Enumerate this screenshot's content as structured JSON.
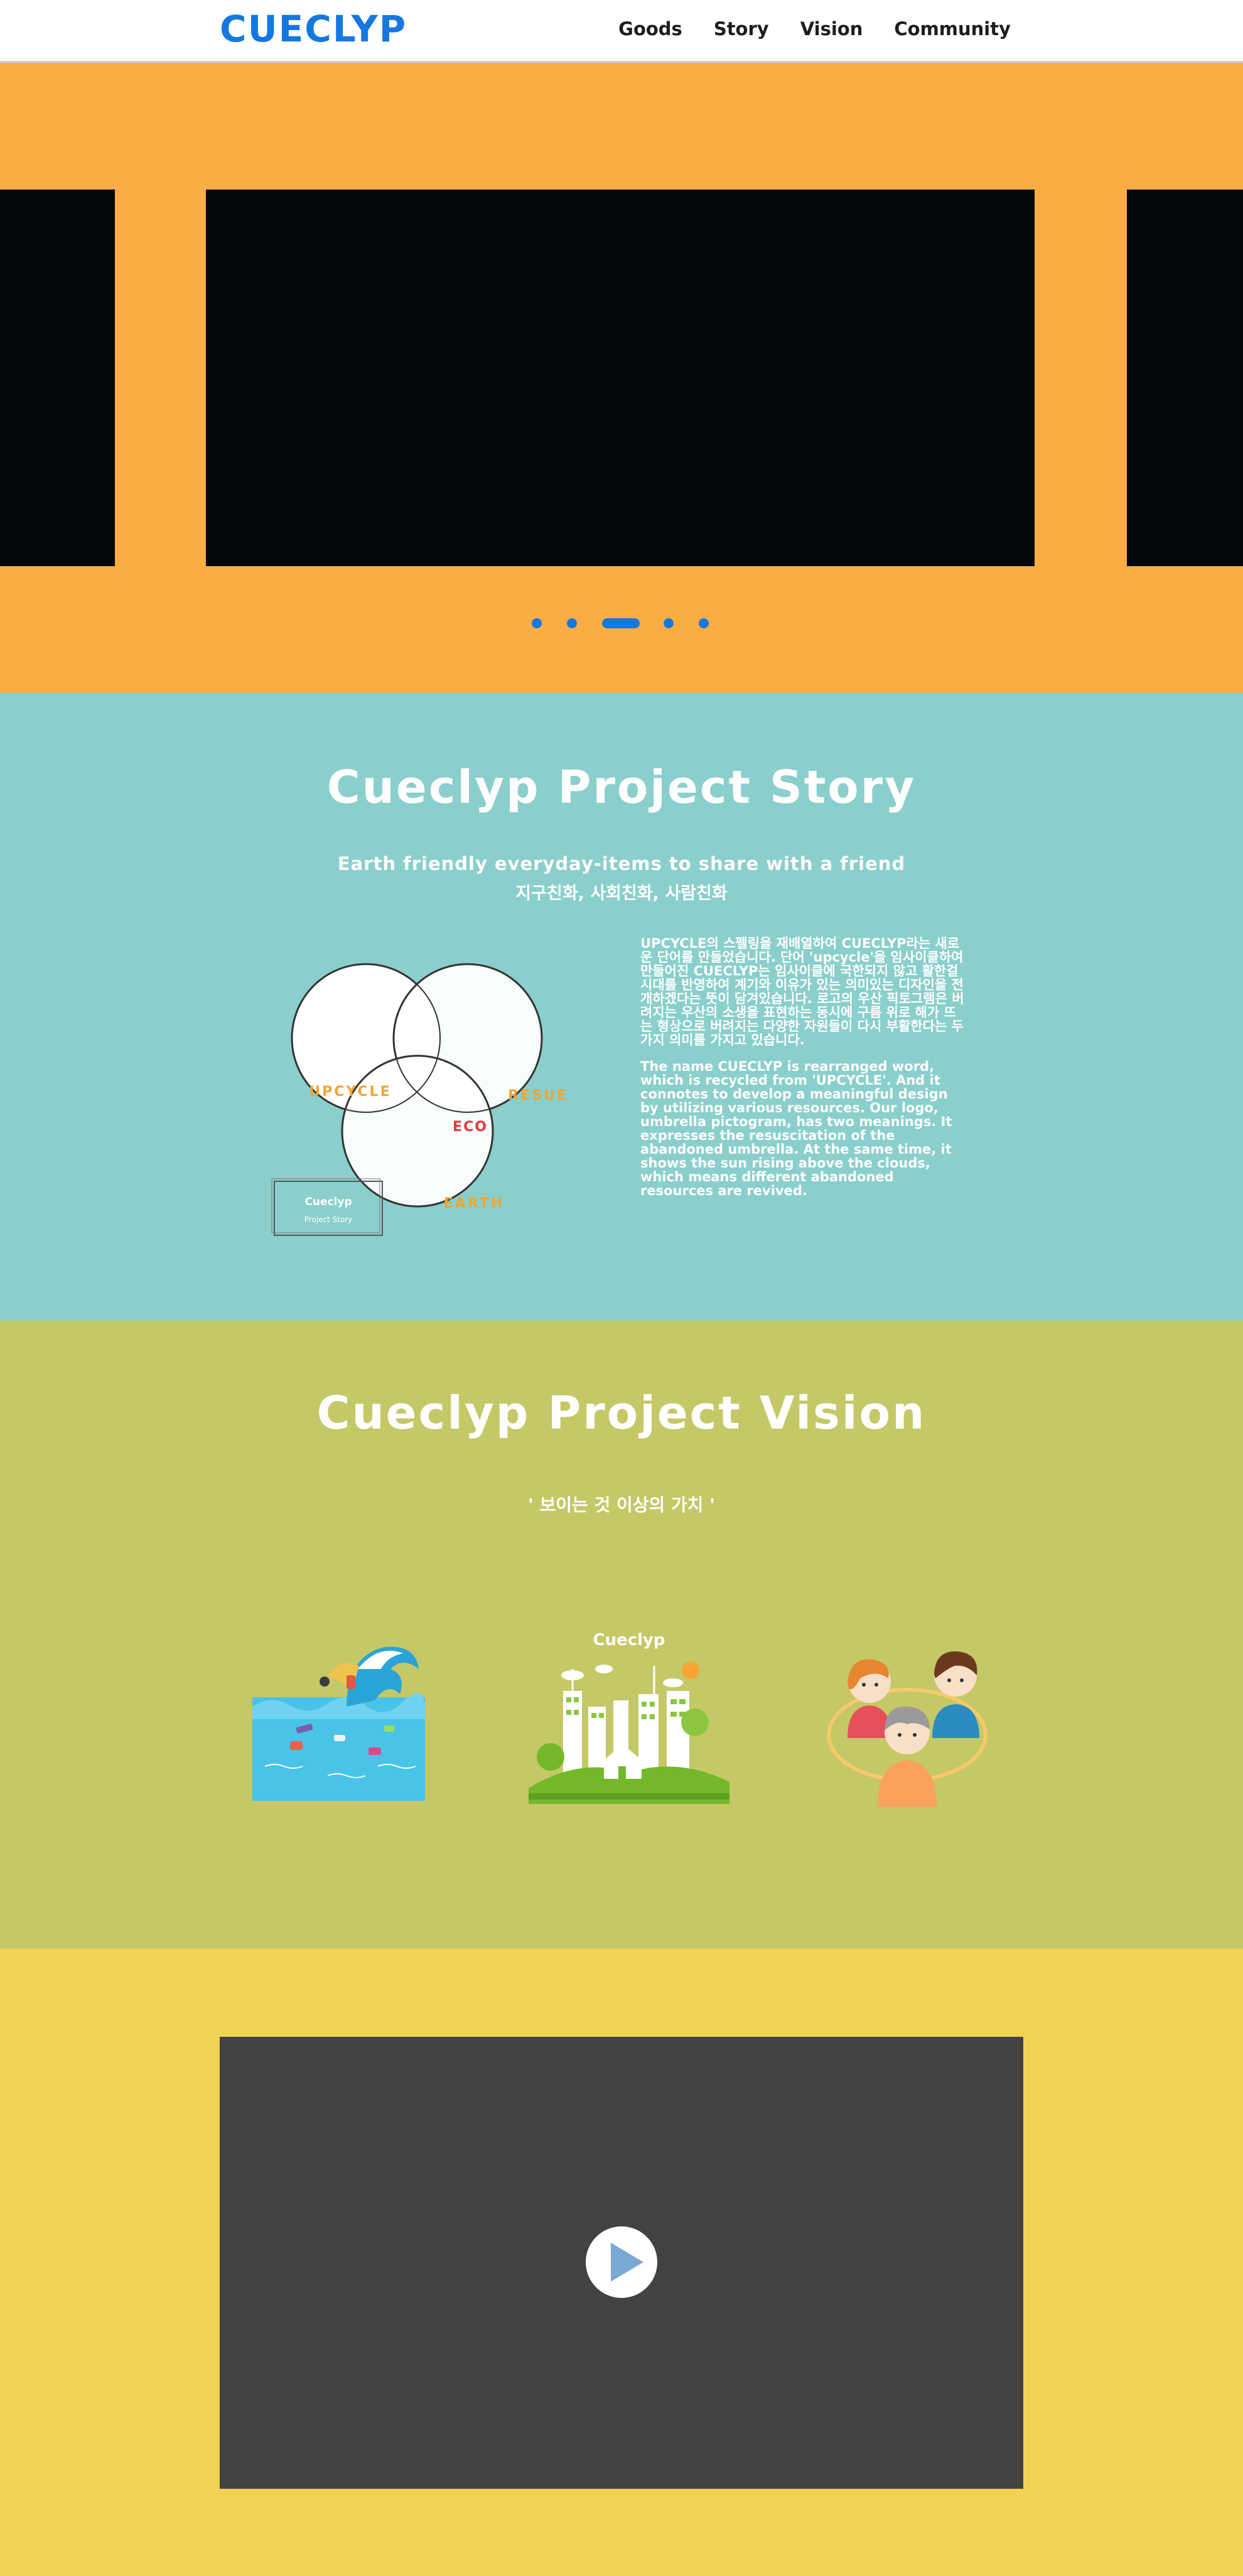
{
  "header": {
    "logo": "CUECLYP",
    "nav": [
      "Goods",
      "Story",
      "Vision",
      "Community"
    ]
  },
  "slider": {
    "slide_count": 5,
    "active_index": 2,
    "dot_color": "#1478e0",
    "background": "#f9ad44"
  },
  "story": {
    "title": "Cueclyp Project Story",
    "subtitle_en": "Earth friendly everyday-items to share with a friend",
    "subtitle_ko": "지구친화, 사회친화, 사람친화",
    "venn": {
      "circle1": "UPCYCLE",
      "circle2": "RESUE",
      "circle3": "EARTH",
      "center": "ECO",
      "card_title": "Cueclyp",
      "card_sub": "Project Story"
    },
    "text_ko": "UPCYCLE의 스펠링을 재배열하여 CUECLYP라는 새로운 단어를 만들었습니다. 단어 'upcycle'을 임사이클하여 만들어진 CUECLYP는 임사이클에 국한되지 않고 활한걸 시대를 반영하여 계기와 이유가 있는 의미있는 디자인을 전개하겠다는 뜻이 담겨있습니다. 로고의 우산 픽토그램은 버려지는 우산의 소생을 표현하는 동시에 구름 위로 해가 뜨는 형상으로 버려지는 다양한 자원들이 다시 부활한다는 두 가지 의미를 가지고 있습니다.",
    "text_en": "The name CUECLYP is rearranged word, which is recycled from 'UPCYCLE'. And it connotes to develop a meaningful design by utilizing various resources. Our logo, umbrella pictogram, has two meanings. It expresses the resuscitation of the abandoned umbrella. At the same time, it shows the sun rising above the clouds, which means different abandoned resources are revived."
  },
  "vision": {
    "title": "Cueclyp Project Vision",
    "tagline": "' 보이는 것 이상의 가치 '",
    "city_label": "Cueclyp"
  },
  "colors": {
    "brand": "#1478e0",
    "orange": "#f9ad44",
    "teal": "#8acfcb",
    "olive": "#c5c866",
    "yellow": "#efd256",
    "video_bg": "#434142",
    "play_triangle": "#7aa9d6"
  }
}
